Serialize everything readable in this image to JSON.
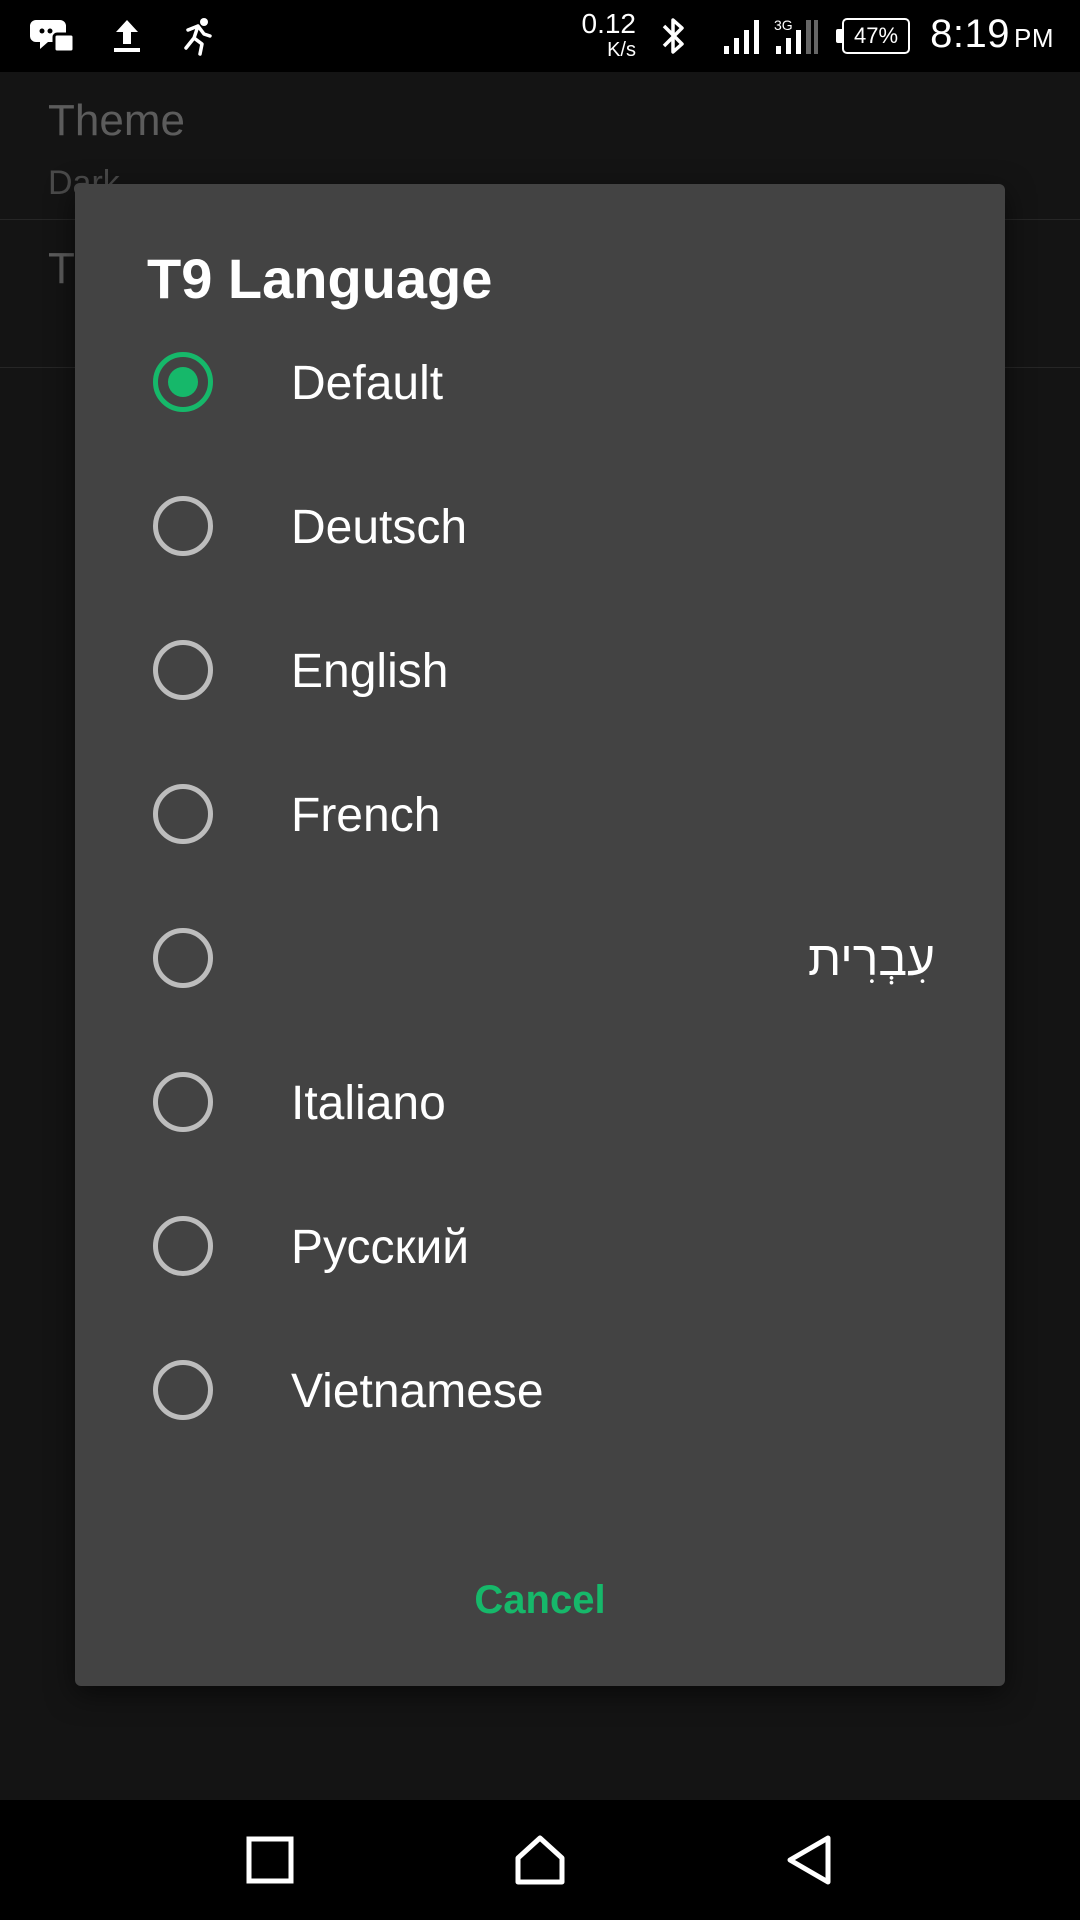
{
  "status_bar": {
    "icons": [
      "messenger-icon",
      "upload-icon",
      "running-icon"
    ],
    "net_speed_value": "0.12",
    "net_speed_unit": "K/s",
    "network_type": "3G",
    "battery": "47%",
    "time": "8:19",
    "ampm": "PM"
  },
  "settings_background": {
    "rows": [
      {
        "title": "Theme",
        "subtitle": "Dark"
      },
      {
        "title": "T",
        "subtitle": ""
      }
    ]
  },
  "dialog": {
    "title": "T9 Language",
    "options": [
      {
        "label": "Default",
        "selected": true
      },
      {
        "label": "Deutsch",
        "selected": false
      },
      {
        "label": "English",
        "selected": false
      },
      {
        "label": "French",
        "selected": false
      },
      {
        "label": "עִבְרִית",
        "selected": false
      },
      {
        "label": "Italiano",
        "selected": false
      },
      {
        "label": "Русский",
        "selected": false
      },
      {
        "label": "Vietnamese",
        "selected": false
      }
    ],
    "cancel_label": "Cancel"
  },
  "colors": {
    "accent": "#16b86a",
    "dialog_bg": "#434343",
    "screen_bg": "#141414"
  },
  "nav_bar": {
    "buttons": [
      "recents-icon",
      "home-icon",
      "back-icon"
    ]
  }
}
